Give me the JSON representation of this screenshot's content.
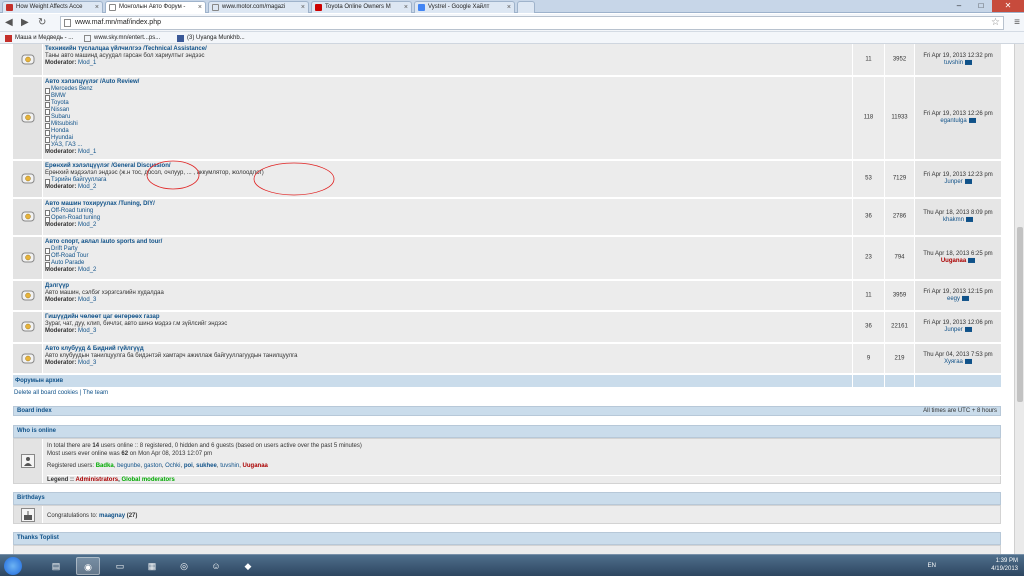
{
  "browser": {
    "tabs": [
      {
        "label": "How Weight Affects Acce",
        "color": "#c4302b"
      },
      {
        "label": "Монголын Авто Форум -",
        "color": "#ffffff"
      },
      {
        "label": "www.motor.com/magazi",
        "color": "#ffffff"
      },
      {
        "label": "Toyota Online Owners M",
        "color": "#cc0000"
      },
      {
        "label": "Vystrel - Google Хайлт",
        "color": "#4285f4"
      }
    ],
    "url": "www.maf.mn/maf/index.php",
    "bookmarks": [
      "Маша и Медведь - ...",
      "www.sky.mn/entert...ps...",
      "(3) Uyanga Munkhb..."
    ]
  },
  "forums": [
    {
      "title": "Техникийн туслалцаа үйлчилгээ /Technical Assistance/",
      "desc": "Таны авто машинд асуудал гарсан бол хариултыг эндээс",
      "subs": [],
      "moderator_label": "Moderator:",
      "moderator": "Mod_1",
      "topics": "11",
      "posts": "3952",
      "last_date": "Fri Apr 19, 2013 12:32 pm",
      "last_user": "tuvshin",
      "last_user_red": false
    },
    {
      "title": "Авто хэлэлцүүлэг /Auto Review/",
      "desc": "",
      "subs": [
        "Mercedes Benz",
        "BMW",
        "Toyota",
        "Nissan",
        "Subaru",
        "Mitsubishi",
        "Honda",
        "Hyundai",
        "УАЗ, ГАЗ ..."
      ],
      "moderator_label": "Moderator:",
      "moderator": "Mod_1",
      "topics": "118",
      "posts": "11933",
      "last_date": "Fri Apr 19, 2013 12:26 pm",
      "last_user": "egantulga",
      "last_user_red": false
    },
    {
      "title": "Ерөнхий хэлэлцүүлэг /General Discussion/",
      "desc": "Ерөнхий мэдээлэл эндээс (ж.н тос, досол, очлуур, ... , аккумлятор, жолоодлог)",
      "subs": [
        "Тэрийн байгууллага"
      ],
      "moderator_label": "Moderator:",
      "moderator": "Mod_2",
      "topics": "53",
      "posts": "7129",
      "last_date": "Fri Apr 19, 2013 12:23 pm",
      "last_user": "Junper",
      "last_user_red": false
    },
    {
      "title": "Авто машин тохируулах /Tuning, DIY/",
      "desc": "",
      "subs": [
        "Off-Road tuning",
        "Open-Road tuning"
      ],
      "moderator_label": "Moderator:",
      "moderator": "Mod_2",
      "topics": "36",
      "posts": "2786",
      "last_date": "Thu Apr 18, 2013 8:09 pm",
      "last_user": "khakmn",
      "last_user_red": false
    },
    {
      "title": "Авто спорт, аялал /auto sports and tour/",
      "desc": "",
      "subs": [
        "Drift Party",
        "Off-Road Tour",
        "Auto Parade"
      ],
      "moderator_label": "Moderator:",
      "moderator": "Mod_2",
      "topics": "23",
      "posts": "794",
      "last_date": "Thu Apr 18, 2013 6:25 pm",
      "last_user": "Uuganaa",
      "last_user_red": true
    },
    {
      "title": "Дэлгүүр",
      "desc": "Авто машин, сэлбэг хэрэгсэлийн худалдаа",
      "subs": [],
      "moderator_label": "Moderator:",
      "moderator": "Mod_3",
      "topics": "11",
      "posts": "3959",
      "last_date": "Fri Apr 19, 2013 12:15 pm",
      "last_user": "eegy",
      "last_user_red": false
    },
    {
      "title": "Гишүүдийн чөлөөт цаг өнгөрөөх газар",
      "desc": "Зураг, чат, дуу, клип, бичлэг, авто шинэ мэдээ г.м зүйлсийг эндээс",
      "subs": [],
      "moderator_label": "Moderator:",
      "moderator": "Mod_3",
      "topics": "36",
      "posts": "22161",
      "last_date": "Fri Apr 19, 2013 12:06 pm",
      "last_user": "Junper",
      "last_user_red": false
    },
    {
      "title": "Авто клубууд & Бидний гүйлгүүд",
      "desc": "Авто клубуудын танилцуулга ба бидэнтэй хамтарч ажиллаж байгууллагуудын танилцуулга",
      "subs": [],
      "moderator_label": "Moderator:",
      "moderator": "Mod_3",
      "topics": "9",
      "posts": "219",
      "last_date": "Thu Apr 04, 2013 7:53 pm",
      "last_user": "Хуягаа",
      "last_user_red": false
    }
  ],
  "archive_label": "Форумын архив",
  "footer_links": "Delete all board cookies | The team",
  "board_index": "Board index",
  "timezone": "All times are UTC + 8 hours",
  "whos_online": {
    "title": "Who is online",
    "line1_pre": "In total there are ",
    "line1_count": "14",
    "line1_post": " users online :: 8 registered, 0 hidden and 6 guests (based on users active over the past 5 minutes)",
    "line2_pre": "Most users ever online was ",
    "line2_count": "62",
    "line2_post": " on Mon Apr 08, 2013 12:07 pm",
    "registered_label": "Registered users: ",
    "users": [
      {
        "name": "Badka",
        "color": "#00aa00",
        "bold": true
      },
      {
        "name": "begunbe",
        "color": "#105289",
        "bold": false
      },
      {
        "name": "gaston",
        "color": "#105289",
        "bold": false
      },
      {
        "name": "Ochki",
        "color": "#105289",
        "bold": false
      },
      {
        "name": "poi",
        "color": "#105289",
        "bold": true
      },
      {
        "name": "sukhee",
        "color": "#105289",
        "bold": true
      },
      {
        "name": "tuvshin",
        "color": "#105289",
        "bold": false
      },
      {
        "name": "Uuganaa",
        "color": "#aa0000",
        "bold": true
      }
    ],
    "legend_label": "Legend :: ",
    "legend_admin": "Administrators",
    "legend_mod": "Global moderators"
  },
  "birthdays": {
    "title": "Birthdays",
    "text": "Congratulations to: ",
    "name": "maagnay",
    "age": "(27)"
  },
  "thanks": {
    "title": "Thanks Toplist"
  },
  "taskbar": {
    "lang": "EN",
    "time": "1:39 PM",
    "date": "4/19/2013"
  }
}
